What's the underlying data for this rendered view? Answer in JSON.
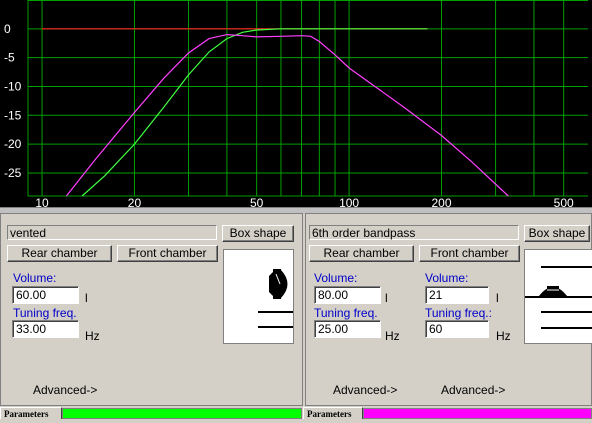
{
  "chart_data": {
    "type": "line",
    "xscale": "log",
    "xlim": [
      9,
      600
    ],
    "ylim": [
      -29,
      5
    ],
    "y_ticks": [
      0,
      -5,
      -10,
      -15,
      -20,
      -25
    ],
    "y_tick_labels": [
      "0",
      "-5",
      "-10",
      "-15",
      "-20",
      "-25"
    ],
    "x_ticks": [
      10,
      20,
      50,
      100,
      200,
      500
    ],
    "x_tick_labels": [
      "10",
      "20",
      "50",
      "100",
      "200",
      "500"
    ],
    "x_grid": [
      9,
      10,
      20,
      30,
      40,
      50,
      60,
      70,
      80,
      90,
      100,
      200,
      300,
      400,
      500
    ],
    "grid": true,
    "colors": {
      "background": "#000000",
      "grid": "#00a000",
      "reference": "#ff2020",
      "vented": "#40ff40",
      "bandpass": "#ff40ff"
    },
    "series": [
      {
        "key": "reference",
        "x": [
          10,
          180
        ],
        "y": [
          0,
          0
        ]
      },
      {
        "key": "vented",
        "x": [
          13.5,
          16,
          20,
          25,
          30,
          35,
          40,
          45,
          50,
          60,
          70,
          100,
          150,
          180
        ],
        "y": [
          -29,
          -25.5,
          -20,
          -13.5,
          -8,
          -4,
          -1.7,
          -0.6,
          -0.2,
          0,
          0,
          0,
          0,
          0
        ]
      },
      {
        "key": "bandpass",
        "x": [
          12,
          15,
          20,
          25,
          30,
          35,
          40,
          45,
          50,
          60,
          70,
          75,
          80,
          90,
          100,
          150,
          200,
          250,
          330
        ],
        "y": [
          -29,
          -22.5,
          -14.5,
          -8.5,
          -4.2,
          -1.7,
          -1.0,
          -1.2,
          -1.4,
          -1.3,
          -1.2,
          -1.3,
          -2.2,
          -4.5,
          -6.8,
          -13.5,
          -18.5,
          -23.0,
          -29
        ]
      }
    ]
  },
  "left_panel": {
    "name": "vented",
    "box_shape_label": "Box shape",
    "rear_chamber_label": "Rear chamber",
    "front_chamber_label": "Front chamber",
    "volume_label": "Volume:",
    "volume_value": "60.00",
    "volume_unit": "l",
    "tuning_label": "Tuning freq.",
    "tuning_value": "33.00",
    "tuning_unit": "Hz",
    "advanced_label": "Advanced->",
    "tab_label": "Parameters",
    "bar_color": "#00ff00"
  },
  "right_panel": {
    "name": "6th order bandpass",
    "box_shape_label": "Box shape",
    "rear_chamber_label": "Rear chamber",
    "front_chamber_label": "Front chamber",
    "rear": {
      "volume_label": "Volume:",
      "volume_value": "80.00",
      "volume_unit": "l",
      "tuning_label": "Tuning freq.",
      "tuning_value": "25.00",
      "tuning_unit": "Hz",
      "advanced_label": "Advanced->"
    },
    "front": {
      "volume_label": "Volume:",
      "volume_value": "21",
      "volume_unit": "l",
      "tuning_label": "Tuning freq.:",
      "tuning_value": "60",
      "tuning_unit": "Hz",
      "advanced_label": "Advanced->"
    },
    "tab_label": "Parameters",
    "bar_color": "#ff00ff"
  }
}
